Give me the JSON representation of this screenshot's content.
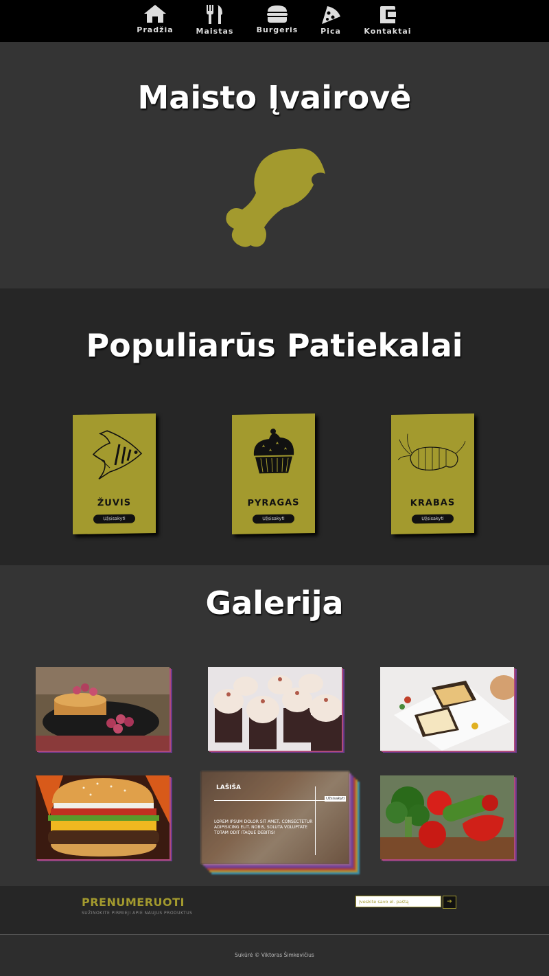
{
  "nav": {
    "items": [
      {
        "label": "Pradžia",
        "icon": "home-icon"
      },
      {
        "label": "Maistas",
        "icon": "utensils-icon"
      },
      {
        "label": "Burgeris",
        "icon": "burger-icon"
      },
      {
        "label": "Pica",
        "icon": "pizza-icon"
      },
      {
        "label": "Kontaktai",
        "icon": "phone-icon"
      }
    ]
  },
  "hero": {
    "title": "Maisto Įvairovė",
    "icon": "drumstick-icon",
    "accent": "#a39a2e"
  },
  "popular": {
    "title": "Populiarūs Patiekalai",
    "cards": [
      {
        "name": "ŽUVIS",
        "button": "Užsisakyti",
        "icon": "fish-icon"
      },
      {
        "name": "PYRAGAS",
        "button": "Užsisakyti",
        "icon": "cupcake-icon"
      },
      {
        "name": "KRABAS",
        "button": "Užsisakyti",
        "icon": "shrimp-icon"
      }
    ]
  },
  "gallery": {
    "title": "Galerija",
    "images": [
      "pancakes",
      "cupcakes",
      "toast-plate",
      "burger",
      "salmon",
      "vegetables"
    ],
    "featured": {
      "title": "LAŠIŠA",
      "tag": "Užsisakyti",
      "text": "LOREM IPSUM DOLOR SIT AMET, CONSECTETUR ADIPISICING ELIT. NOBIS, SOLUTA VOLUPTATE TOTAM ODIT ITAQUE DEBITIS!"
    }
  },
  "subscribe": {
    "title": "PRENUMERUOTI",
    "subtitle": "SUŽINOKITE PIRMIEJI APIE NAUJUS PRODUKTUS",
    "placeholder": "Įveskite savo el. paštą",
    "button_icon": "arrow-right-icon"
  },
  "footer": {
    "text": "Sukūrė © Viktoras Šimkevičius"
  }
}
